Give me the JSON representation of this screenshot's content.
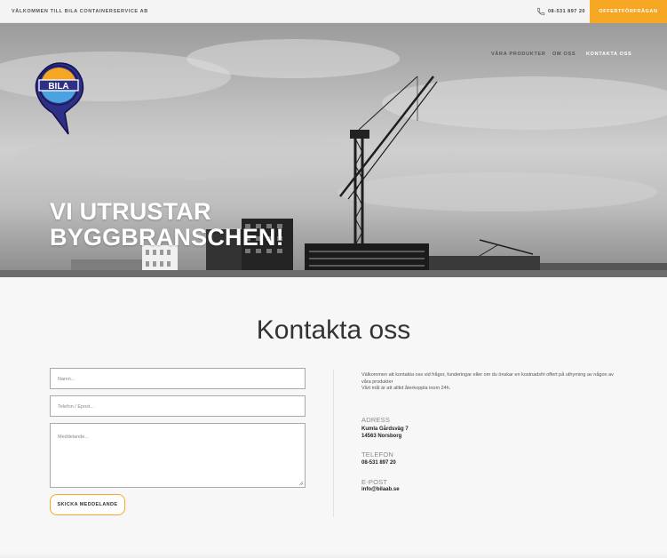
{
  "topbar": {
    "welcome": "VÄLKOMMEN TILL BILA CONTAINERSERVICE AB",
    "phone": "08-531 897 20",
    "cta_label": "OFFERTFÖRFRÅGAN",
    "accent_color": "#f5a623"
  },
  "nav": {
    "items": [
      {
        "label": "VÅRA PRODUKTER"
      },
      {
        "label": "OM OSS"
      },
      {
        "label": "KONTAKTA OSS"
      }
    ]
  },
  "logo": {
    "text": "BILA"
  },
  "hero": {
    "headline_line1": "VI UTRUSTAR",
    "headline_line2": "BYGGBRANSCHEN!"
  },
  "contact": {
    "title": "Kontakta oss",
    "name_placeholder": "Namn...",
    "contact_placeholder": "Telefon / Epost...",
    "message_placeholder": "Meddelande...",
    "submit_label": "SKICKA MEDDELANDE",
    "intro_line1": "Välkommen att kontakta oss vid frågor, funderingar eller om du önskar en kostnadsfri offert på uthyrning av någon av våra produkter",
    "intro_line2": "Vårt mål är att alltid återkoppla inom 24h.",
    "address_label": "ADRESS",
    "address_line1": "Kumla Gårdsväg 7",
    "address_line2": "14563 Norsborg",
    "phone_label": "TELEFON",
    "phone_value": "08-531 897 20",
    "email_label": "E-POST",
    "email_value": "info@bilaab.se"
  }
}
